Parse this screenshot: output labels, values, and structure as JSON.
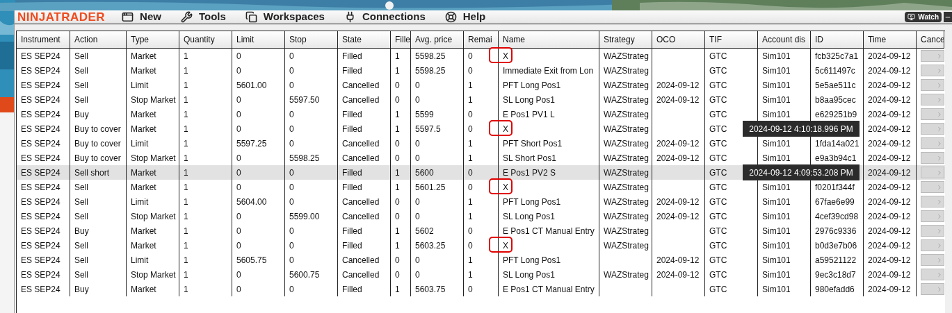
{
  "menu_bar": {
    "logo": "NINJATRADER",
    "items": [
      {
        "label": "New",
        "kind": "new"
      },
      {
        "label": "Tools",
        "kind": "tools"
      },
      {
        "label": "Workspaces",
        "kind": "workspaces"
      },
      {
        "label": "Connections",
        "kind": "connections"
      },
      {
        "label": "Help",
        "kind": "help"
      }
    ],
    "watch_button": "Watch"
  },
  "table": {
    "columns": [
      "Instrument",
      "Action",
      "Type",
      "Quantity",
      "Limit",
      "Stop",
      "State",
      "Fille",
      "Avg. price",
      "Remai",
      "Name",
      "Strategy",
      "OCO",
      "TIF",
      "Account dis",
      "ID",
      "Time",
      "Cance"
    ],
    "rows": [
      {
        "selected": false,
        "highlighted": true,
        "cells": [
          "ES SEP24",
          "Sell",
          "Market",
          "1",
          "0",
          "0",
          "Filled",
          "1",
          "5598.25",
          "0",
          "X",
          "WAZStrateg",
          null,
          "GTC",
          "Sim101",
          "fcb325c7a1",
          "2024-09-12"
        ]
      },
      {
        "selected": false,
        "highlighted": false,
        "cells": [
          "ES SEP24",
          "Sell",
          "Market",
          "1",
          "0",
          "0",
          "Filled",
          "1",
          "5598.25",
          "0",
          "Immediate Exit from Lon",
          "WAZStrateg",
          null,
          "GTC",
          "Sim101",
          "5c611497c",
          "2024-09-12"
        ]
      },
      {
        "selected": false,
        "highlighted": false,
        "cells": [
          "ES SEP24",
          "Sell",
          "Limit",
          "1",
          "5601.00",
          "0",
          "Cancelled",
          "0",
          "0",
          "1",
          "PFT Long Pos1",
          "WAZStrateg",
          "2024-09-12",
          "GTC",
          "Sim101",
          "5e5ae511c",
          "2024-09-12"
        ]
      },
      {
        "selected": false,
        "highlighted": false,
        "cells": [
          "ES SEP24",
          "Sell",
          "Stop Market",
          "1",
          "0",
          "5597.50",
          "Cancelled",
          "0",
          "0",
          "1",
          "SL Long Pos1",
          "WAZStrateg",
          "2024-09-12",
          "GTC",
          "Sim101",
          "b8aa95cec",
          "2024-09-12"
        ]
      },
      {
        "selected": false,
        "highlighted": false,
        "cells": [
          "ES SEP24",
          "Buy",
          "Market",
          "1",
          "0",
          "0",
          "Filled",
          "1",
          "5599",
          "0",
          "E Pos1 PV1 L",
          "WAZStrateg",
          null,
          "GTC",
          "Sim101",
          "e629251b9",
          "2024-09-12"
        ]
      },
      {
        "selected": false,
        "highlighted": true,
        "tooltip": "2024-09-12 4:10:18.996 PM",
        "cells": [
          "ES SEP24",
          "Buy to cover",
          "Market",
          "1",
          "0",
          "0",
          "Filled",
          "1",
          "5597.5",
          "0",
          "X",
          "WAZStrateg",
          null,
          "GTC",
          null,
          null,
          "2024-09-12"
        ]
      },
      {
        "selected": false,
        "highlighted": false,
        "cells": [
          "ES SEP24",
          "Buy to cover",
          "Limit",
          "1",
          "5597.25",
          "0",
          "Cancelled",
          "0",
          "0",
          "1",
          "PFT Short Pos1",
          "WAZStrateg",
          "2024-09-12",
          "GTC",
          "Sim101",
          "1fda14a021",
          "2024-09-12"
        ]
      },
      {
        "selected": false,
        "highlighted": false,
        "cells": [
          "ES SEP24",
          "Buy to cover",
          "Stop Market",
          "1",
          "0",
          "5598.25",
          "Cancelled",
          "0",
          "0",
          "1",
          "SL Short Pos1",
          "WAZStrateg",
          "2024-09-12",
          "GTC",
          "Sim101",
          "e9a3b94c1",
          "2024-09-12"
        ]
      },
      {
        "selected": true,
        "highlighted": false,
        "tooltip": "2024-09-12 4:09:53.208 PM",
        "cells": [
          "ES SEP24",
          "Sell short",
          "Market",
          "1",
          "0",
          "0",
          "Filled",
          "1",
          "5600",
          "0",
          "E Pos1 PV2 S",
          "WAZStrateg",
          null,
          "GTC",
          null,
          null,
          "2024-09-12"
        ]
      },
      {
        "selected": false,
        "highlighted": true,
        "cells": [
          "ES SEP24",
          "Sell",
          "Market",
          "1",
          "0",
          "0",
          "Filled",
          "1",
          "5601.25",
          "0",
          "X",
          "WAZStrateg",
          null,
          "GTC",
          "Sim101",
          "f0201f344f",
          "2024-09-12"
        ]
      },
      {
        "selected": false,
        "highlighted": false,
        "cells": [
          "ES SEP24",
          "Sell",
          "Limit",
          "1",
          "5604.00",
          "0",
          "Cancelled",
          "0",
          "0",
          "1",
          "PFT Long Pos1",
          "WAZStrateg",
          "2024-09-12",
          "GTC",
          "Sim101",
          "67fae6e99",
          "2024-09-12"
        ]
      },
      {
        "selected": false,
        "highlighted": false,
        "cells": [
          "ES SEP24",
          "Sell",
          "Stop Market",
          "1",
          "0",
          "5599.00",
          "Cancelled",
          "0",
          "0",
          "1",
          "SL Long Pos1",
          "WAZStrateg",
          "2024-09-12",
          "GTC",
          "Sim101",
          "4cef39cd98",
          "2024-09-12"
        ]
      },
      {
        "selected": false,
        "highlighted": false,
        "cells": [
          "ES SEP24",
          "Buy",
          "Market",
          "1",
          "0",
          "0",
          "Filled",
          "1",
          "5602",
          "0",
          "E Pos1 CT Manual Entry",
          "WAZStrateg",
          null,
          "GTC",
          "Sim101",
          "2976c9336",
          "2024-09-12"
        ]
      },
      {
        "selected": false,
        "highlighted": true,
        "cells": [
          "ES SEP24",
          "Sell",
          "Market",
          "1",
          "0",
          "0",
          "Filled",
          "1",
          "5603.25",
          "0",
          "X",
          "WAZStrateg",
          null,
          "GTC",
          "Sim101",
          "b0d3e7b06",
          "2024-09-12"
        ]
      },
      {
        "selected": false,
        "highlighted": false,
        "cells": [
          "ES SEP24",
          "Sell",
          "Limit",
          "1",
          "5605.75",
          "0",
          "Cancelled",
          "0",
          "0",
          "1",
          "PFT Long Pos1",
          null,
          "2024-09-12",
          "GTC",
          "Sim101",
          "a59521122",
          "2024-09-12"
        ]
      },
      {
        "selected": false,
        "highlighted": false,
        "cells": [
          "ES SEP24",
          "Sell",
          "Stop Market",
          "1",
          "0",
          "5600.75",
          "Cancelled",
          "0",
          "0",
          "1",
          "SL Long Pos1",
          "WAZStrateg",
          "2024-09-12",
          "GTC",
          "Sim101",
          "9ec3c18d7",
          "2024-09-12"
        ]
      },
      {
        "selected": false,
        "highlighted": false,
        "cells": [
          "ES SEP24",
          "Buy",
          "Market",
          "1",
          "0",
          "0",
          "Filled",
          "1",
          "5603.75",
          "0",
          "E Pos1 CT Manual Entry",
          null,
          null,
          "GTC",
          "Sim101",
          "980efadd6",
          "2024-09-12"
        ]
      }
    ]
  }
}
